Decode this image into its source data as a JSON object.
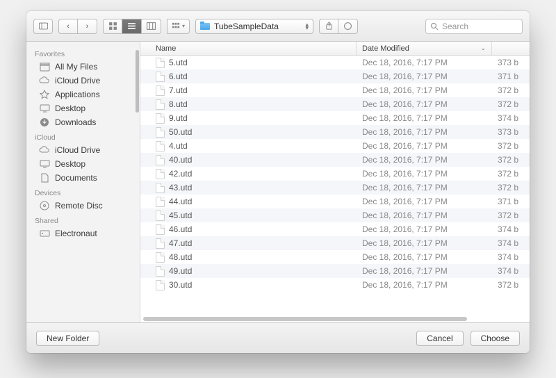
{
  "toolbar": {
    "path_label": "TubeSampleData",
    "search_placeholder": "Search"
  },
  "sidebar": {
    "sections": [
      {
        "title": "Favorites",
        "items": [
          {
            "icon": "all-my-files-icon",
            "label": "All My Files"
          },
          {
            "icon": "cloud-icon",
            "label": "iCloud Drive"
          },
          {
            "icon": "applications-icon",
            "label": "Applications"
          },
          {
            "icon": "desktop-icon",
            "label": "Desktop"
          },
          {
            "icon": "downloads-icon",
            "label": "Downloads"
          }
        ]
      },
      {
        "title": "iCloud",
        "items": [
          {
            "icon": "cloud-icon",
            "label": "iCloud Drive"
          },
          {
            "icon": "desktop-icon",
            "label": "Desktop"
          },
          {
            "icon": "documents-icon",
            "label": "Documents"
          }
        ]
      },
      {
        "title": "Devices",
        "items": [
          {
            "icon": "disc-icon",
            "label": "Remote Disc"
          }
        ]
      },
      {
        "title": "Shared",
        "items": [
          {
            "icon": "server-icon",
            "label": "Electronaut"
          }
        ]
      }
    ]
  },
  "columns": {
    "name": "Name",
    "date": "Date Modified"
  },
  "files": [
    {
      "name": "5.utd",
      "date": "Dec 18, 2016, 7:17 PM",
      "size": "373 b"
    },
    {
      "name": "6.utd",
      "date": "Dec 18, 2016, 7:17 PM",
      "size": "371 b"
    },
    {
      "name": "7.utd",
      "date": "Dec 18, 2016, 7:17 PM",
      "size": "372 b"
    },
    {
      "name": "8.utd",
      "date": "Dec 18, 2016, 7:17 PM",
      "size": "372 b"
    },
    {
      "name": "9.utd",
      "date": "Dec 18, 2016, 7:17 PM",
      "size": "374 b"
    },
    {
      "name": "50.utd",
      "date": "Dec 18, 2016, 7:17 PM",
      "size": "373 b"
    },
    {
      "name": "4.utd",
      "date": "Dec 18, 2016, 7:17 PM",
      "size": "372 b"
    },
    {
      "name": "40.utd",
      "date": "Dec 18, 2016, 7:17 PM",
      "size": "372 b"
    },
    {
      "name": "42.utd",
      "date": "Dec 18, 2016, 7:17 PM",
      "size": "372 b"
    },
    {
      "name": "43.utd",
      "date": "Dec 18, 2016, 7:17 PM",
      "size": "372 b"
    },
    {
      "name": "44.utd",
      "date": "Dec 18, 2016, 7:17 PM",
      "size": "371 b"
    },
    {
      "name": "45.utd",
      "date": "Dec 18, 2016, 7:17 PM",
      "size": "372 b"
    },
    {
      "name": "46.utd",
      "date": "Dec 18, 2016, 7:17 PM",
      "size": "374 b"
    },
    {
      "name": "47.utd",
      "date": "Dec 18, 2016, 7:17 PM",
      "size": "374 b"
    },
    {
      "name": "48.utd",
      "date": "Dec 18, 2016, 7:17 PM",
      "size": "374 b"
    },
    {
      "name": "49.utd",
      "date": "Dec 18, 2016, 7:17 PM",
      "size": "374 b"
    },
    {
      "name": "30.utd",
      "date": "Dec 18, 2016, 7:17 PM",
      "size": "372 b"
    }
  ],
  "footer": {
    "new_folder": "New Folder",
    "cancel": "Cancel",
    "choose": "Choose"
  }
}
